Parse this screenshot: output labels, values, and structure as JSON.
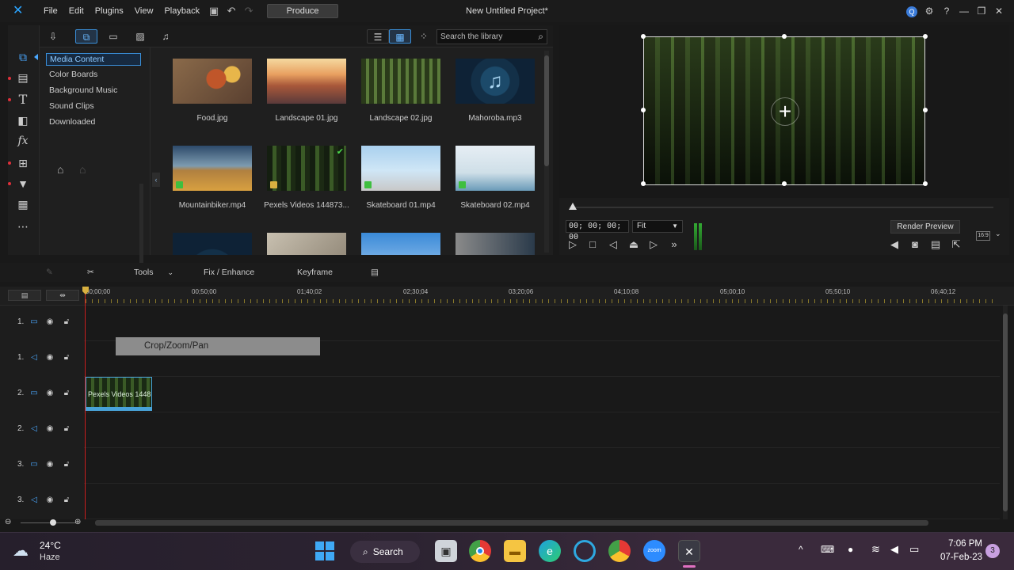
{
  "titlebar": {
    "app_logo": "powerdirector-logo",
    "menus": [
      "File",
      "Edit",
      "Plugins",
      "View",
      "Playback"
    ],
    "produce_label": "Produce",
    "project_title": "New Untitled Project*",
    "notif_badge": "Q"
  },
  "library": {
    "search_placeholder": "Search the library",
    "categories": [
      {
        "label": "Media Content",
        "active": true
      },
      {
        "label": "Color Boards",
        "active": false
      },
      {
        "label": "Background Music",
        "active": false
      },
      {
        "label": "Sound Clips",
        "active": false
      },
      {
        "label": "Downloaded",
        "active": false
      }
    ],
    "media": [
      {
        "label": "Food.jpg",
        "kind": "image"
      },
      {
        "label": "Landscape 01.jpg",
        "kind": "image"
      },
      {
        "label": "Landscape 02.jpg",
        "kind": "image"
      },
      {
        "label": "Mahoroba.mp3",
        "kind": "audio"
      },
      {
        "label": "Mountainbiker.mp4",
        "kind": "video"
      },
      {
        "label": "Pexels Videos 144873...",
        "kind": "video"
      },
      {
        "label": "Skateboard 01.mp4",
        "kind": "video"
      },
      {
        "label": "Skateboard 02.mp4",
        "kind": "video"
      }
    ]
  },
  "preview": {
    "timecode": "00; 00; 00; 00",
    "fit_label": "Fit",
    "render_preview_label": "Render Preview",
    "aspect_label": "16:9"
  },
  "edit_toolbar": {
    "tools_label": "Tools",
    "fix_enhance_label": "Fix / Enhance",
    "keyframe_label": "Keyframe"
  },
  "timeline": {
    "ticks": [
      "00;00;00",
      "00;50;00",
      "01;40;02",
      "02;30;04",
      "03;20;06",
      "04;10;08",
      "05;00;10",
      "05;50;10",
      "06;40;12"
    ],
    "tracks": [
      {
        "num": "1.",
        "type": "video"
      },
      {
        "num": "1.",
        "type": "audio"
      },
      {
        "num": "2.",
        "type": "video"
      },
      {
        "num": "2.",
        "type": "audio"
      },
      {
        "num": "3.",
        "type": "video"
      },
      {
        "num": "3.",
        "type": "audio"
      }
    ],
    "crop_clip_label": "Crop/Zoom/Pan",
    "video_clip_label": "Pexels Videos 1448"
  },
  "taskbar": {
    "temperature": "24°C",
    "weather": "Haze",
    "search_label": "Search",
    "time": "7:06 PM",
    "date": "07-Feb-23",
    "notification_count": "3"
  },
  "colors": {
    "accent": "#3a8fd9",
    "playhead": "#d02020",
    "record_dot": "#e0303a"
  }
}
